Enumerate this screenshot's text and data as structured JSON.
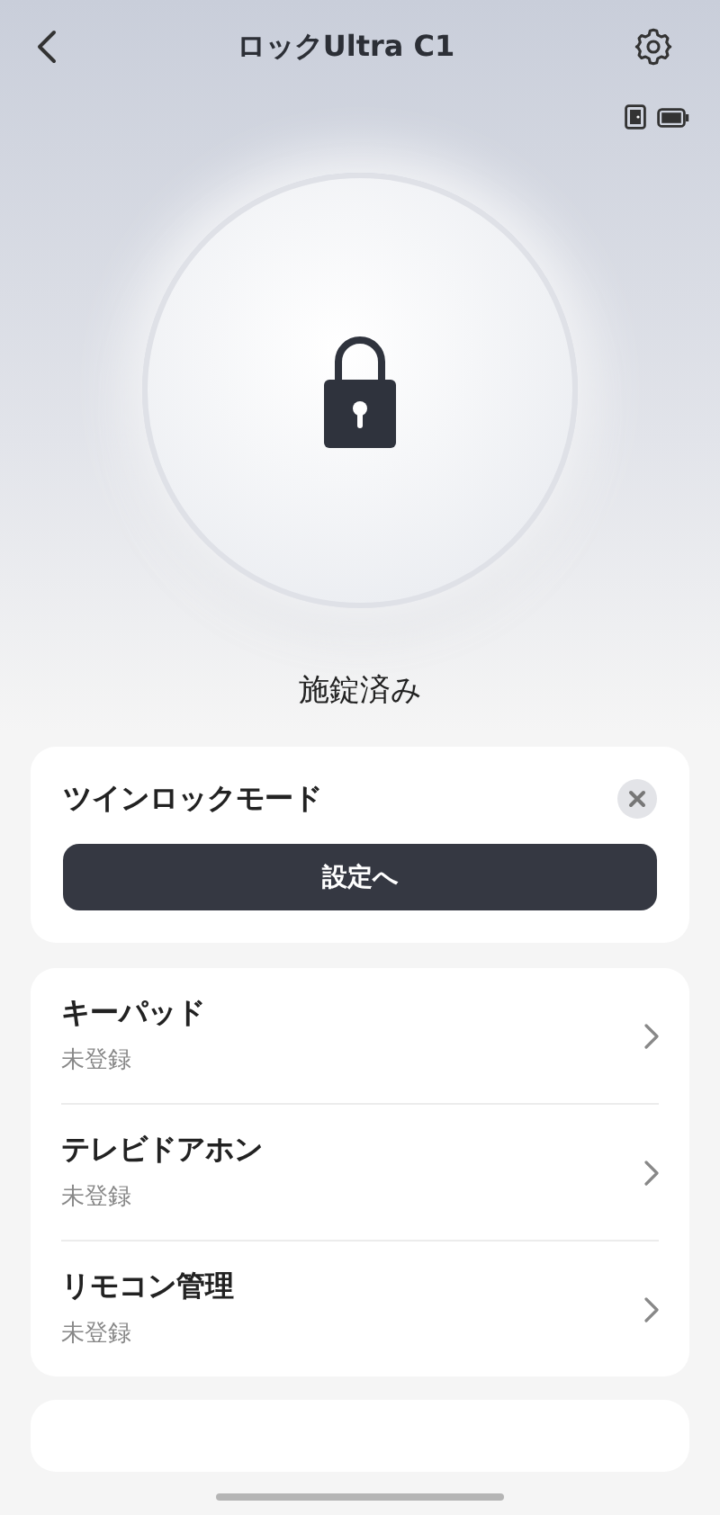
{
  "header": {
    "title": "ロックUltra C1"
  },
  "lock": {
    "status": "施錠済み"
  },
  "twin_lock_card": {
    "title": "ツインロックモード",
    "button": "設定へ"
  },
  "menu": [
    {
      "title": "キーパッド",
      "subtitle": "未登録"
    },
    {
      "title": "テレビドアホン",
      "subtitle": "未登録"
    },
    {
      "title": "リモコン管理",
      "subtitle": "未登録"
    }
  ]
}
